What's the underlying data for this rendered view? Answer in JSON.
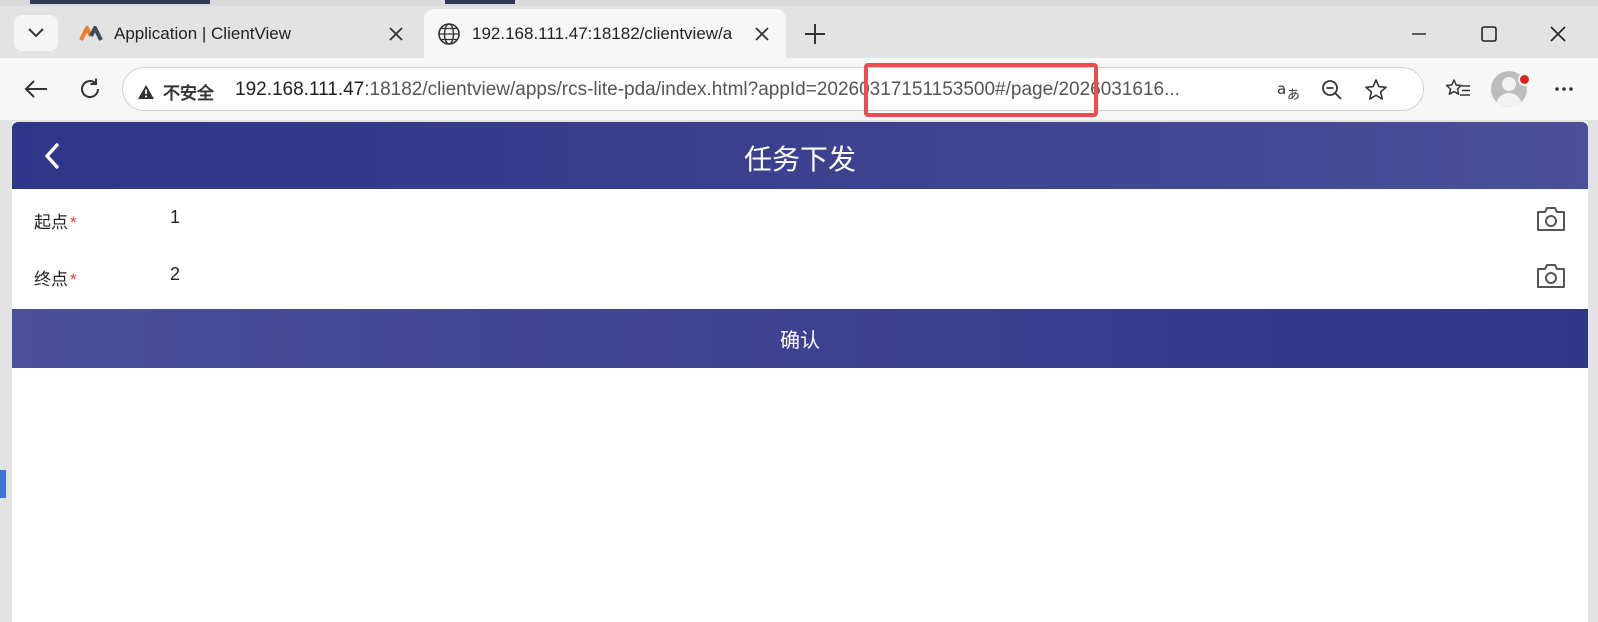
{
  "browser": {
    "tabs": [
      {
        "title": "Application | ClientView",
        "active": false
      },
      {
        "title": "192.168.111.47:18182/clientview/a",
        "active": true
      }
    ],
    "security_label": "不安全",
    "url_host": "192.168.111.47",
    "url_rest": ":18182/clientview/apps/rcs-lite-pda/index.html?appId=20260317151153500#/page/2026031616...",
    "highlighted_text": "=20260317151153500#",
    "colors": {
      "highlight": "#ef4b50",
      "header": "#3b418e"
    }
  },
  "app": {
    "title": "任务下发",
    "fields": [
      {
        "label": "起点",
        "required_mark": "*",
        "value": "1"
      },
      {
        "label": "终点",
        "required_mark": "*",
        "value": "2"
      }
    ],
    "confirm_label": "确认"
  }
}
